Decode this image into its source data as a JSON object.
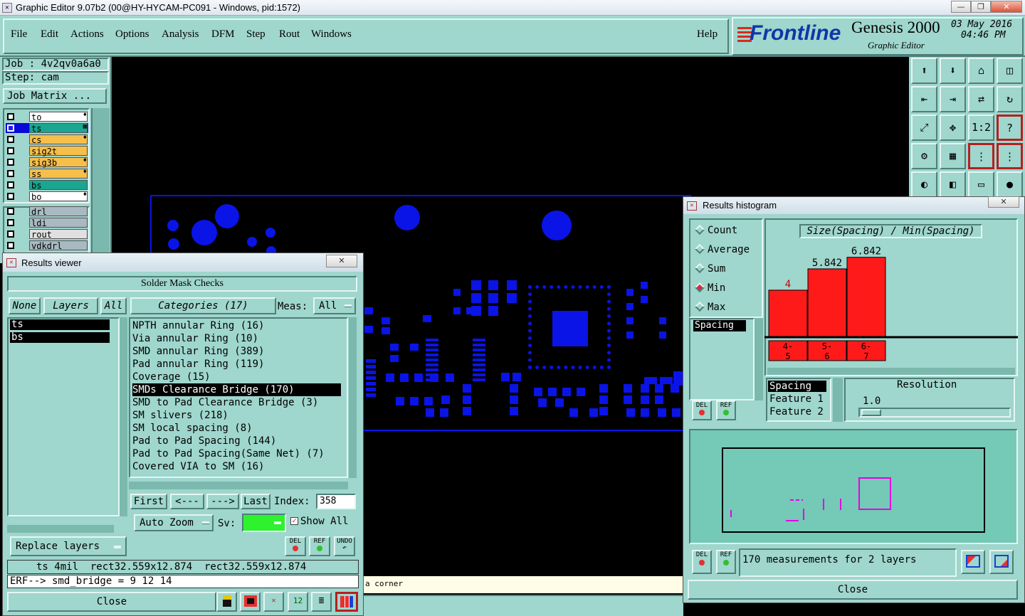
{
  "window": {
    "title": "Graphic Editor 9.07b2 (00@HY-HYCAM-PC091 - Windows, pid:1572)"
  },
  "menu": {
    "items": [
      "File",
      "Edit",
      "Actions",
      "Options",
      "Analysis",
      "DFM",
      "Step",
      "Rout",
      "Windows"
    ],
    "help": "Help"
  },
  "brand": {
    "logo": "Frontline",
    "product": "Genesis 2000",
    "subtitle": "Graphic Editor",
    "date": "03 May 2016",
    "time": "04:46 PM"
  },
  "job": {
    "job_label": "Job : 4v2qv0a6a0",
    "step_label": "Step: cam",
    "matrix_button": "Job Matrix ..."
  },
  "layers": [
    {
      "name": "to",
      "color": "#ffffff",
      "mark": "♦"
    },
    {
      "name": "ts",
      "color": "#1aa690",
      "mark": "▦",
      "active": true
    },
    {
      "name": "cs",
      "color": "#f6bf4a",
      "mark": "♦"
    },
    {
      "name": "sig2t",
      "color": "#f6bf4a",
      "mark": ""
    },
    {
      "name": "sig3b",
      "color": "#f6bf4a",
      "mark": "♦"
    },
    {
      "name": "ss",
      "color": "#f6bf4a",
      "mark": "♦"
    },
    {
      "name": "bs",
      "color": "#1aa690",
      "mark": ""
    },
    {
      "name": "bo",
      "color": "#ffffff",
      "mark": "♦"
    }
  ],
  "layers2": [
    {
      "name": "drl",
      "color": "#a9b9c2"
    },
    {
      "name": "ldi",
      "color": "#a9b9c2"
    },
    {
      "name": "rout",
      "color": "#e0e0e0"
    },
    {
      "name": "vdkdrl",
      "color": "#a9b9c2"
    }
  ],
  "results_viewer": {
    "title": "Results viewer",
    "header": "Solder Mask Checks",
    "none_btn": "None",
    "layers_btn": "Layers",
    "all_btn": "All",
    "categories_btn": "Categories (17)",
    "meas_label": "Meas:",
    "meas_value": "All",
    "layer_list": [
      "ts",
      "bs"
    ],
    "categories": [
      "NPTH annular Ring (16)",
      "Via annular Ring (10)",
      "SMD annular Ring (389)",
      "Pad annular Ring (119)",
      "Coverage (15)",
      "SMDs Clearance Bridge (170)",
      "SMD to Pad Clearance Bridge (3)",
      "SM slivers (218)",
      "SM local spacing (8)",
      "Pad to Pad Spacing (144)",
      "Pad to Pad Spacing(Same Net) (7)",
      "Covered VIA to SM (16)"
    ],
    "selected_category": 5,
    "first_btn": "First",
    "prev_btn": "<---",
    "next_btn": "--->",
    "last_btn": "Last",
    "index_label": "Index:",
    "index_value": "358",
    "auto_zoom": "Auto Zoom",
    "sv_label": "Sv:",
    "show_all": "Show All",
    "replace_layers": "Replace layers",
    "del": "DEL",
    "ref": "REF",
    "undo": "UNDO",
    "status_line": "ts 4mil  rect32.559x12.874  rect32.559x12.874",
    "erf_line": "ERF--> smd_bridge = 9 12 14",
    "close": "Close"
  },
  "canvas": {
    "status_text": "a corner"
  },
  "histogram": {
    "title": "Results histogram",
    "radios": [
      {
        "label": "Count",
        "on": false
      },
      {
        "label": "Average",
        "on": false
      },
      {
        "label": "Sum",
        "on": false
      },
      {
        "label": "Min",
        "on": true
      },
      {
        "label": "Max",
        "on": false
      }
    ],
    "chart_title": "Size(Spacing) / Min(Spacing)",
    "measure_list": [
      "Spacing"
    ],
    "attr_list": [
      "Spacing",
      "Feature 1",
      "Feature 2"
    ],
    "resolution_label": "Resolution",
    "resolution_value": "1.0",
    "summary": "170 measurements for 2 layers",
    "del": "DEL",
    "ref": "REF",
    "close": "Close"
  },
  "chart_data": {
    "type": "bar",
    "title": "Size(Spacing) / Min(Spacing)",
    "categories": [
      "4-5",
      "5-6",
      "6-7"
    ],
    "cat_lines": [
      [
        "4-",
        "5"
      ],
      [
        "5-",
        "6"
      ],
      [
        "6-",
        "7"
      ]
    ],
    "values": [
      4,
      5.842,
      6.842
    ],
    "value_labels": [
      "4",
      "5.842",
      "6.842"
    ],
    "ylim": [
      0,
      7.5
    ],
    "bar_color": "#ff1a1a"
  }
}
